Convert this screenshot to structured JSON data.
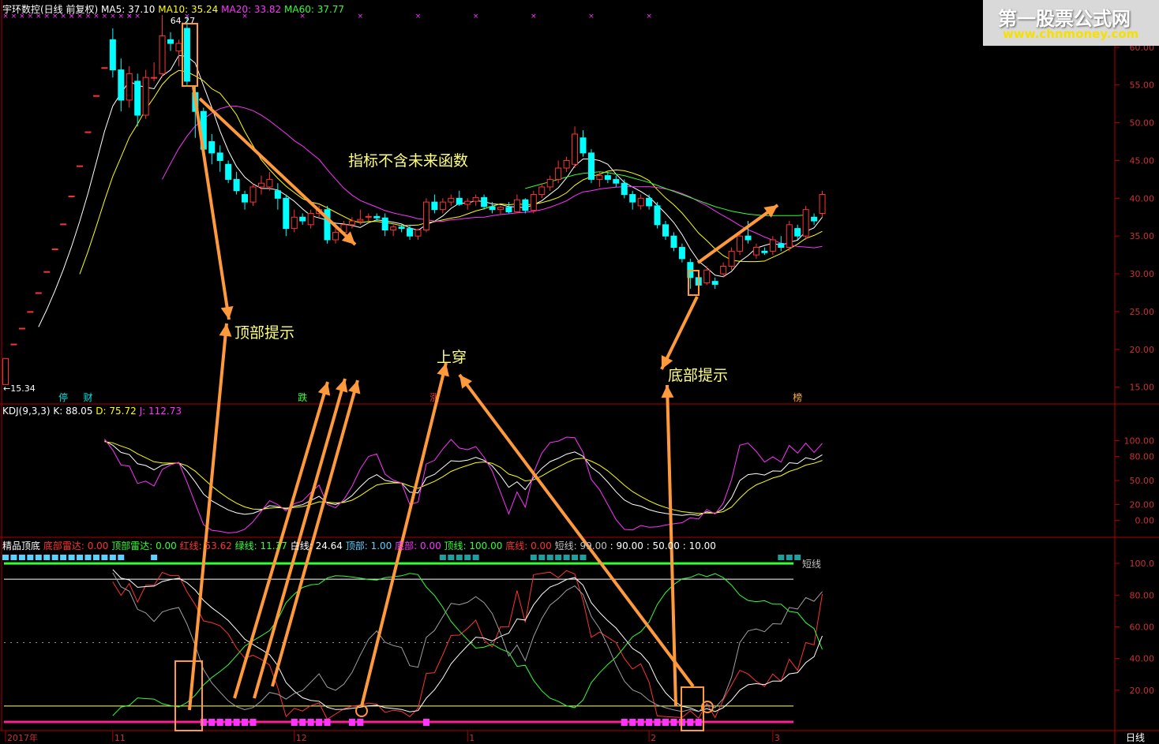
{
  "price_header": {
    "name": "宇环数控(日线 前复权)",
    "ma5": "MA5: 37.10",
    "ma10": "MA10: 35.24",
    "ma20": "MA20: 33.82",
    "ma60": "MA60: 37.77"
  },
  "kdj_header": {
    "name": "KDJ(9,3,3)",
    "k": "K: 88.05",
    "d": "D: 75.72",
    "j": "J: 112.73"
  },
  "ind_header": {
    "name": "精品顶底",
    "items": [
      {
        "text": "底部雷达: 0.00",
        "color": "#ff3232"
      },
      {
        "text": "顶部雷达: 0.00",
        "color": "#32ff32"
      },
      {
        "text": "红线: 53.62",
        "color": "#ff3232"
      },
      {
        "text": "绿线: 11.37",
        "color": "#32ff32"
      },
      {
        "text": "白线: 24.64",
        "color": "#ffffff"
      },
      {
        "text": "顶部: 1.00",
        "color": "#5ad2ff"
      },
      {
        "text": "底部: 0.00",
        "color": "#ff32ff"
      },
      {
        "text": "顶线: 100.00",
        "color": "#32ff32"
      },
      {
        "text": "底线: 0.00",
        "color": "#ff3232"
      },
      {
        "text": "短线: 99.00",
        "color": "#c0c0c0"
      },
      {
        "text": ": 90.00",
        "color": "#ffffff"
      },
      {
        "text": ": 50.00",
        "color": "#ffffff"
      },
      {
        "text": ": 10.00",
        "color": "#ffffff"
      }
    ]
  },
  "watermark": {
    "line1": "第一股票公式网",
    "line2": "www.chnmoney.com"
  },
  "annotations": {
    "top_hint": "顶部提示",
    "bottom_hint": "底部提示",
    "cross_up": "上穿",
    "no_future": "指标不含未来函数"
  },
  "price_labels": {
    "high": "64.27",
    "low": "15.34"
  },
  "event_tags": [
    {
      "text": "停",
      "color": "#00e0e0"
    },
    {
      "text": "财",
      "color": "#00e0e0"
    },
    {
      "text": "跌",
      "color": "#32ff32"
    },
    {
      "text": "涨",
      "color": "#ff3232"
    },
    {
      "text": "榜",
      "color": "#ffb040"
    }
  ],
  "short_line_label": "短线",
  "date_labels": [
    "2017年",
    "11",
    "12",
    "1",
    "2",
    "3"
  ],
  "period_label": "日线",
  "colors": {
    "up": "#ff3232",
    "down": "#00ffff",
    "ma5": "#ffffff",
    "ma10": "#ffff00",
    "ma20": "#ff32ff",
    "ma60": "#32ff32",
    "annotation": "#ff9a3c",
    "text_yellow": "#ffff80"
  },
  "chart_data": [
    {
      "type": "candlestick",
      "title": "宇环数控(日线 前复权)",
      "y_ticks": [
        60,
        55,
        50,
        45,
        40,
        35,
        30,
        25,
        20,
        15
      ],
      "ylim": [
        13.5,
        65
      ],
      "y_tick_labels": [
        "60.00",
        "55.00",
        "50.00",
        "45.00",
        "40.00",
        "35.00",
        "30.00",
        "25.00",
        "20.00",
        "15.00"
      ],
      "candles": [
        {
          "o": 15.34,
          "h": 18.8,
          "l": 15.34,
          "c": 18.8
        },
        {
          "o": 20.7,
          "h": 20.7,
          "l": 20.7,
          "c": 20.7
        },
        {
          "o": 22.8,
          "h": 22.8,
          "l": 22.8,
          "c": 22.8
        },
        {
          "o": 25.0,
          "h": 25.0,
          "l": 25.0,
          "c": 25.0
        },
        {
          "o": 27.5,
          "h": 27.5,
          "l": 27.5,
          "c": 27.5
        },
        {
          "o": 30.3,
          "h": 30.3,
          "l": 30.3,
          "c": 30.3
        },
        {
          "o": 33.3,
          "h": 33.3,
          "l": 33.3,
          "c": 33.3
        },
        {
          "o": 36.6,
          "h": 36.6,
          "l": 36.6,
          "c": 36.6
        },
        {
          "o": 40.3,
          "h": 40.3,
          "l": 40.3,
          "c": 40.3
        },
        {
          "o": 44.3,
          "h": 44.3,
          "l": 44.3,
          "c": 44.3
        },
        {
          "o": 48.8,
          "h": 48.8,
          "l": 48.8,
          "c": 48.8
        },
        {
          "o": 53.6,
          "h": 53.6,
          "l": 53.6,
          "c": 53.6
        },
        {
          "o": 57.3,
          "h": 57.3,
          "l": 57.3,
          "c": 57.3
        },
        {
          "o": 61.0,
          "h": 62.5,
          "l": 56.0,
          "c": 57.0
        },
        {
          "o": 57.0,
          "h": 58.5,
          "l": 51.5,
          "c": 53.0
        },
        {
          "o": 53.0,
          "h": 57.5,
          "l": 52.0,
          "c": 56.5
        },
        {
          "o": 55.5,
          "h": 56.5,
          "l": 49.5,
          "c": 51.0
        },
        {
          "o": 51.0,
          "h": 57.0,
          "l": 50.5,
          "c": 56.0
        },
        {
          "o": 56.0,
          "h": 58.0,
          "l": 55.5,
          "c": 56.0
        },
        {
          "o": 56.5,
          "h": 64.27,
          "l": 56.0,
          "c": 61.5
        },
        {
          "o": 61.0,
          "h": 62.0,
          "l": 59.5,
          "c": 60.5
        },
        {
          "o": 59.5,
          "h": 61.0,
          "l": 57.5,
          "c": 60.5
        },
        {
          "o": 62.5,
          "h": 64.0,
          "l": 55.0,
          "c": 55.5
        },
        {
          "o": 54.0,
          "h": 55.0,
          "l": 48.0,
          "c": 51.5
        },
        {
          "o": 51.5,
          "h": 52.0,
          "l": 46.0,
          "c": 46.5
        },
        {
          "o": 47.5,
          "h": 48.5,
          "l": 44.5,
          "c": 46.0
        },
        {
          "o": 46.0,
          "h": 47.0,
          "l": 43.5,
          "c": 45.0
        },
        {
          "o": 44.5,
          "h": 45.0,
          "l": 42.0,
          "c": 42.5
        },
        {
          "o": 42.5,
          "h": 43.5,
          "l": 40.5,
          "c": 41.0
        },
        {
          "o": 40.5,
          "h": 41.0,
          "l": 38.5,
          "c": 39.5
        },
        {
          "o": 39.5,
          "h": 42.0,
          "l": 39.0,
          "c": 41.5
        },
        {
          "o": 41.5,
          "h": 43.0,
          "l": 40.5,
          "c": 42.0
        },
        {
          "o": 41.5,
          "h": 43.5,
          "l": 41.0,
          "c": 42.5
        },
        {
          "o": 41.0,
          "h": 42.0,
          "l": 38.5,
          "c": 40.0
        },
        {
          "o": 40.0,
          "h": 40.5,
          "l": 35.0,
          "c": 36.0
        },
        {
          "o": 36.0,
          "h": 38.5,
          "l": 35.5,
          "c": 37.5
        },
        {
          "o": 37.5,
          "h": 38.0,
          "l": 36.5,
          "c": 37.0
        },
        {
          "o": 36.5,
          "h": 38.5,
          "l": 36.0,
          "c": 38.0
        },
        {
          "o": 38.0,
          "h": 39.0,
          "l": 37.5,
          "c": 38.5
        },
        {
          "o": 38.5,
          "h": 39.0,
          "l": 34.0,
          "c": 34.5
        },
        {
          "o": 34.5,
          "h": 36.0,
          "l": 34.0,
          "c": 35.5
        },
        {
          "o": 35.5,
          "h": 37.0,
          "l": 35.0,
          "c": 36.5
        },
        {
          "o": 36.5,
          "h": 37.5,
          "l": 36.0,
          "c": 37.0
        },
        {
          "o": 37.0,
          "h": 38.5,
          "l": 36.5,
          "c": 37.2
        },
        {
          "o": 37.5,
          "h": 38.0,
          "l": 37.0,
          "c": 37.6
        },
        {
          "o": 37.6,
          "h": 38.0,
          "l": 37.0,
          "c": 37.4
        },
        {
          "o": 37.4,
          "h": 38.0,
          "l": 35.0,
          "c": 35.8
        },
        {
          "o": 35.8,
          "h": 36.5,
          "l": 35.0,
          "c": 36.2
        },
        {
          "o": 36.2,
          "h": 36.5,
          "l": 35.5,
          "c": 36.0
        },
        {
          "o": 36.0,
          "h": 36.5,
          "l": 34.5,
          "c": 35.0
        },
        {
          "o": 35.0,
          "h": 36.0,
          "l": 34.5,
          "c": 35.8
        },
        {
          "o": 35.8,
          "h": 40.0,
          "l": 35.5,
          "c": 39.5
        },
        {
          "o": 39.5,
          "h": 40.5,
          "l": 38.0,
          "c": 38.5
        },
        {
          "o": 38.5,
          "h": 40.0,
          "l": 38.0,
          "c": 39.5
        },
        {
          "o": 39.5,
          "h": 40.5,
          "l": 39.0,
          "c": 40.0
        },
        {
          "o": 40.0,
          "h": 41.0,
          "l": 39.0,
          "c": 39.2
        },
        {
          "o": 39.2,
          "h": 40.0,
          "l": 38.5,
          "c": 39.6
        },
        {
          "o": 39.6,
          "h": 40.5,
          "l": 39.0,
          "c": 40.1
        },
        {
          "o": 40.1,
          "h": 40.5,
          "l": 38.5,
          "c": 38.9
        },
        {
          "o": 38.9,
          "h": 39.5,
          "l": 38.0,
          "c": 38.5
        },
        {
          "o": 38.5,
          "h": 39.0,
          "l": 37.8,
          "c": 38.8
        },
        {
          "o": 38.8,
          "h": 39.5,
          "l": 38.0,
          "c": 38.2
        },
        {
          "o": 38.2,
          "h": 40.5,
          "l": 38.0,
          "c": 39.8
        },
        {
          "o": 39.8,
          "h": 40.0,
          "l": 38.0,
          "c": 38.4
        },
        {
          "o": 38.4,
          "h": 41.0,
          "l": 38.0,
          "c": 40.5
        },
        {
          "o": 40.5,
          "h": 42.0,
          "l": 40.0,
          "c": 41.5
        },
        {
          "o": 41.5,
          "h": 43.0,
          "l": 41.0,
          "c": 42.5
        },
        {
          "o": 42.5,
          "h": 45.0,
          "l": 42.0,
          "c": 44.0
        },
        {
          "o": 44.0,
          "h": 45.5,
          "l": 43.5,
          "c": 45.0
        },
        {
          "o": 44.5,
          "h": 49.5,
          "l": 44.0,
          "c": 48.5
        },
        {
          "o": 48.0,
          "h": 49.0,
          "l": 45.5,
          "c": 46.0
        },
        {
          "o": 46.0,
          "h": 46.5,
          "l": 42.0,
          "c": 42.5
        },
        {
          "o": 42.5,
          "h": 43.5,
          "l": 41.5,
          "c": 43.0
        },
        {
          "o": 43.0,
          "h": 43.5,
          "l": 42.0,
          "c": 42.5
        },
        {
          "o": 42.5,
          "h": 43.0,
          "l": 41.5,
          "c": 42.0
        },
        {
          "o": 42.0,
          "h": 42.5,
          "l": 40.0,
          "c": 40.5
        },
        {
          "o": 40.5,
          "h": 41.0,
          "l": 38.5,
          "c": 39.5
        },
        {
          "o": 39.0,
          "h": 40.5,
          "l": 38.5,
          "c": 40.0
        },
        {
          "o": 40.0,
          "h": 40.5,
          "l": 38.5,
          "c": 39.0
        },
        {
          "o": 39.0,
          "h": 39.5,
          "l": 36.0,
          "c": 36.5
        },
        {
          "o": 36.5,
          "h": 37.0,
          "l": 34.5,
          "c": 35.0
        },
        {
          "o": 35.0,
          "h": 35.5,
          "l": 33.0,
          "c": 33.5
        },
        {
          "o": 33.5,
          "h": 34.0,
          "l": 31.5,
          "c": 32.0
        },
        {
          "o": 31.5,
          "h": 32.0,
          "l": 28.0,
          "c": 29.5
        },
        {
          "o": 29.5,
          "h": 30.5,
          "l": 28.0,
          "c": 28.5
        },
        {
          "o": 28.8,
          "h": 31.0,
          "l": 28.5,
          "c": 30.5
        },
        {
          "o": 29.0,
          "h": 29.5,
          "l": 28.0,
          "c": 28.6
        },
        {
          "o": 30.0,
          "h": 31.5,
          "l": 29.5,
          "c": 31.0
        },
        {
          "o": 31.0,
          "h": 33.5,
          "l": 30.5,
          "c": 33.0
        },
        {
          "o": 33.0,
          "h": 35.5,
          "l": 32.5,
          "c": 35.0
        },
        {
          "o": 35.0,
          "h": 37.0,
          "l": 34.0,
          "c": 34.5
        },
        {
          "o": 32.5,
          "h": 34.0,
          "l": 32.0,
          "c": 33.5
        },
        {
          "o": 33.0,
          "h": 33.5,
          "l": 32.5,
          "c": 32.8
        },
        {
          "o": 33.0,
          "h": 35.0,
          "l": 32.5,
          "c": 34.5
        },
        {
          "o": 34.0,
          "h": 35.0,
          "l": 33.0,
          "c": 33.5
        },
        {
          "o": 33.5,
          "h": 37.0,
          "l": 33.0,
          "c": 36.5
        },
        {
          "o": 36.0,
          "h": 36.5,
          "l": 34.5,
          "c": 35.0
        },
        {
          "o": 35.0,
          "h": 39.0,
          "l": 34.5,
          "c": 38.5
        },
        {
          "o": 37.5,
          "h": 38.0,
          "l": 36.5,
          "c": 37.0
        },
        {
          "o": 38.0,
          "h": 41.0,
          "l": 37.5,
          "c": 40.5
        }
      ],
      "ma60": [
        null,
        null,
        null,
        null,
        null,
        null,
        null,
        null,
        null,
        null,
        null,
        null,
        null,
        null,
        null,
        null,
        null,
        null,
        null,
        null,
        null,
        null,
        null,
        null,
        null,
        null,
        null,
        null,
        null,
        null,
        null,
        null,
        null,
        null,
        null,
        null,
        null,
        null,
        null,
        null,
        null,
        null,
        null,
        null,
        null,
        null,
        null,
        null,
        null,
        null,
        null,
        null,
        null,
        null,
        null,
        null,
        null,
        null,
        null,
        null,
        null,
        null,
        null,
        41.3,
        41.6,
        41.9,
        42.2,
        42.5,
        42.8,
        43.1,
        43.3,
        43.4,
        43.5,
        43.4,
        43.2,
        43.0,
        42.7,
        42.4,
        42.1,
        41.7,
        41.3,
        40.9,
        40.5,
        40.1,
        39.7,
        39.3,
        38.9,
        38.6,
        38.3,
        38.1,
        37.9,
        37.8,
        37.7,
        37.7,
        37.7,
        37.7,
        37.7,
        37.8
      ]
    },
    {
      "type": "line",
      "title": "KDJ(9,3,3)",
      "series_names": [
        "K",
        "D",
        "J"
      ],
      "y_ticks": [
        100,
        80,
        50,
        20,
        0
      ],
      "ylim": [
        -20,
        130
      ],
      "y_tick_labels": [
        "100.00",
        "80.00",
        "50.00",
        "20.00",
        "0.00"
      ]
    },
    {
      "type": "line",
      "title": "精品顶底",
      "series_names": [
        "红线",
        "绿线",
        "白线",
        "短线",
        "顶线",
        "底线"
      ],
      "y_ticks": [
        100,
        80,
        60,
        40,
        20
      ],
      "ylim": [
        -5,
        110
      ],
      "y_tick_labels": [
        "100.0",
        "80.00",
        "60.00",
        "40.00",
        "20.00"
      ],
      "hlines": [
        100,
        90,
        50,
        10,
        0
      ]
    }
  ]
}
